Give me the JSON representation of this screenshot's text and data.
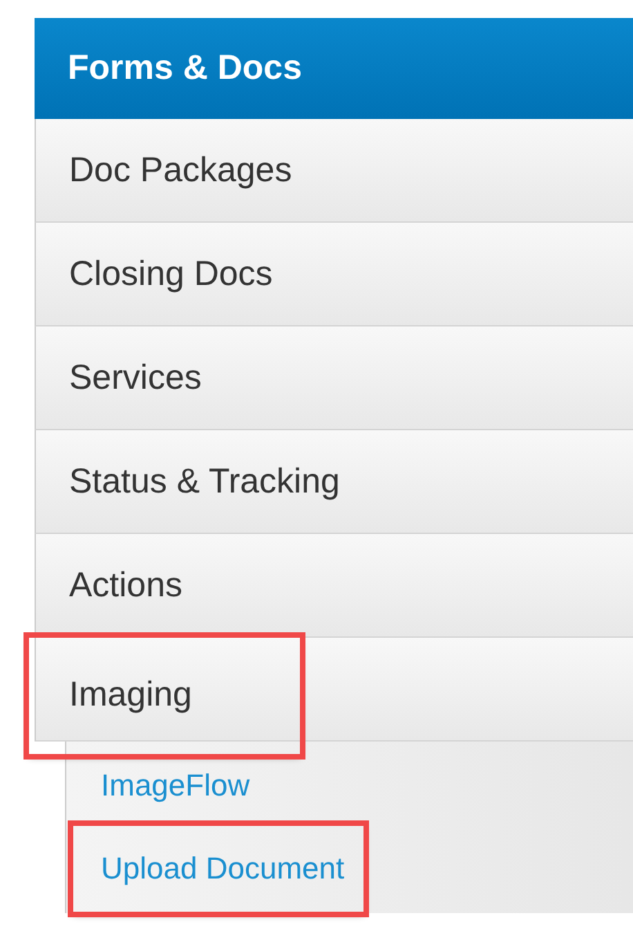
{
  "menu": {
    "title": "Forms & Docs",
    "items": [
      {
        "label": "Doc Packages",
        "highlighted": false
      },
      {
        "label": "Closing Docs",
        "highlighted": false
      },
      {
        "label": "Services",
        "highlighted": false
      },
      {
        "label": "Status & Tracking",
        "highlighted": false
      },
      {
        "label": "Actions",
        "highlighted": false
      },
      {
        "label": "Imaging",
        "highlighted": true,
        "children": [
          {
            "label": "ImageFlow",
            "highlighted": false
          },
          {
            "label": "Upload Document",
            "highlighted": true
          }
        ]
      }
    ]
  }
}
